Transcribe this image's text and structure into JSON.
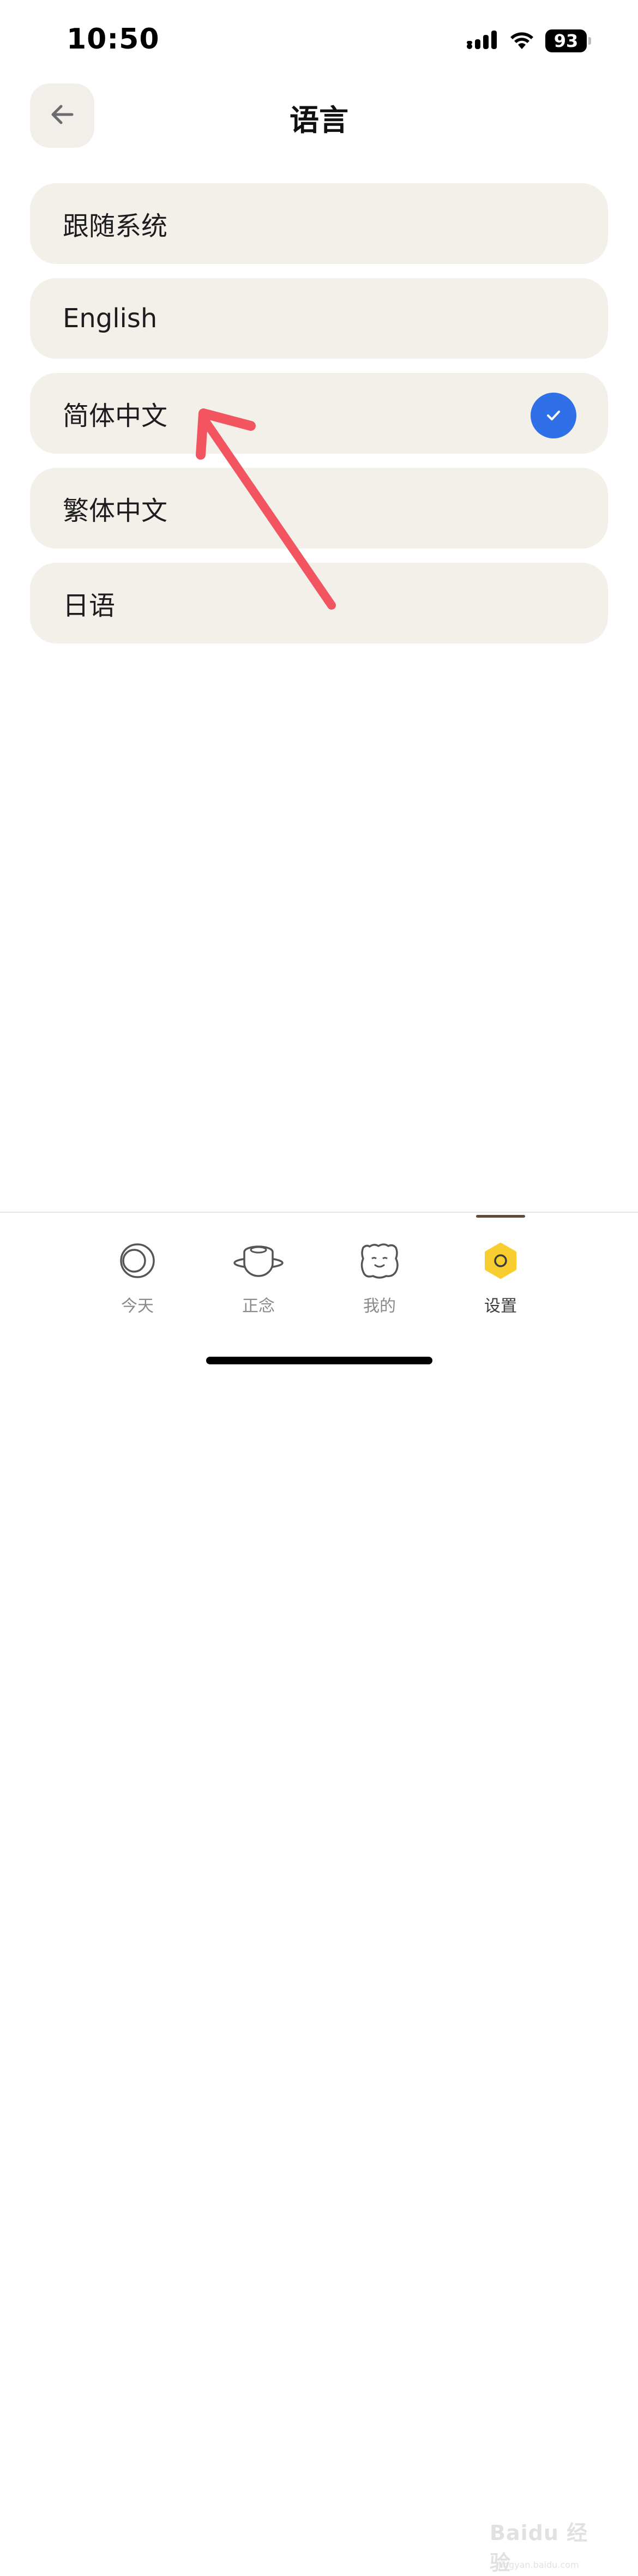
{
  "status_bar": {
    "time": "10:50",
    "battery_level": "93"
  },
  "header": {
    "title": "语言"
  },
  "languages": [
    {
      "label": "跟随系统",
      "selected": false
    },
    {
      "label": "English",
      "selected": false
    },
    {
      "label": "简体中文",
      "selected": true
    },
    {
      "label": "繁体中文",
      "selected": false
    },
    {
      "label": "日语",
      "selected": false
    }
  ],
  "tab_bar": {
    "active_index": 3,
    "tabs": [
      {
        "label": "今天",
        "icon": "moon-circle-icon"
      },
      {
        "label": "正念",
        "icon": "planet-icon"
      },
      {
        "label": "我的",
        "icon": "smiley-cloud-icon"
      },
      {
        "label": "设置",
        "icon": "hexagon-nut-icon"
      }
    ]
  },
  "colors": {
    "card_bg": "#f3f0ea",
    "check_blue": "#2f6fe8",
    "arrow_red": "#f2555f",
    "settings_yellow": "#f7cd2f"
  },
  "watermark": {
    "text": "Baidu 经验",
    "sub": "jingyan.baidu.com"
  }
}
